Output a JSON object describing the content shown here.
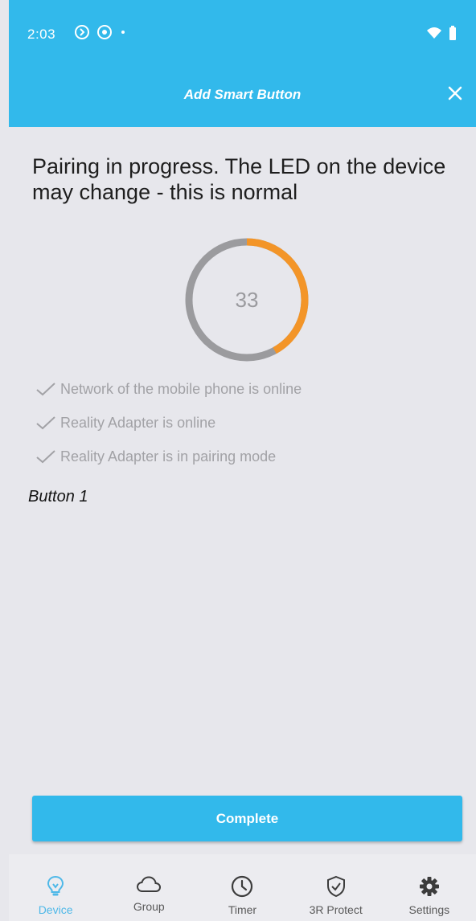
{
  "status_bar": {
    "time": "2:03",
    "left_icons": [
      "sync-icon",
      "circle-app-icon",
      "dot-icon"
    ],
    "right_icons": [
      "wifi-icon",
      "battery-icon"
    ]
  },
  "header": {
    "title": "Add Smart Button",
    "close_icon": "close-icon",
    "background_color": "#32b9eb"
  },
  "pairing": {
    "headline": "Pairing in progress. The LED on the device may change - this is normal",
    "progress_value": 33,
    "progress_fraction": 0.42,
    "progress_color": "#f39528",
    "track_color": "#9b9b9e",
    "checks": [
      {
        "label": "Network of the mobile phone is online",
        "icon": "check-icon"
      },
      {
        "label": "Reality Adapter is online",
        "icon": "check-icon"
      },
      {
        "label": "Reality Adapter is in pairing mode",
        "icon": "check-icon"
      }
    ],
    "button_name": "Button 1"
  },
  "complete_button": {
    "label": "Complete"
  },
  "tabbar": {
    "tabs": [
      {
        "label": "Device",
        "icon": "lightbulb-icon",
        "active": true
      },
      {
        "label": "Group",
        "icon": "cloud-icon",
        "active": false
      },
      {
        "label": "Timer",
        "icon": "clock-icon",
        "active": false
      },
      {
        "label": "3R Protect",
        "icon": "shield-check-icon",
        "active": false
      },
      {
        "label": "Settings",
        "icon": "gear-icon",
        "active": false
      }
    ]
  }
}
